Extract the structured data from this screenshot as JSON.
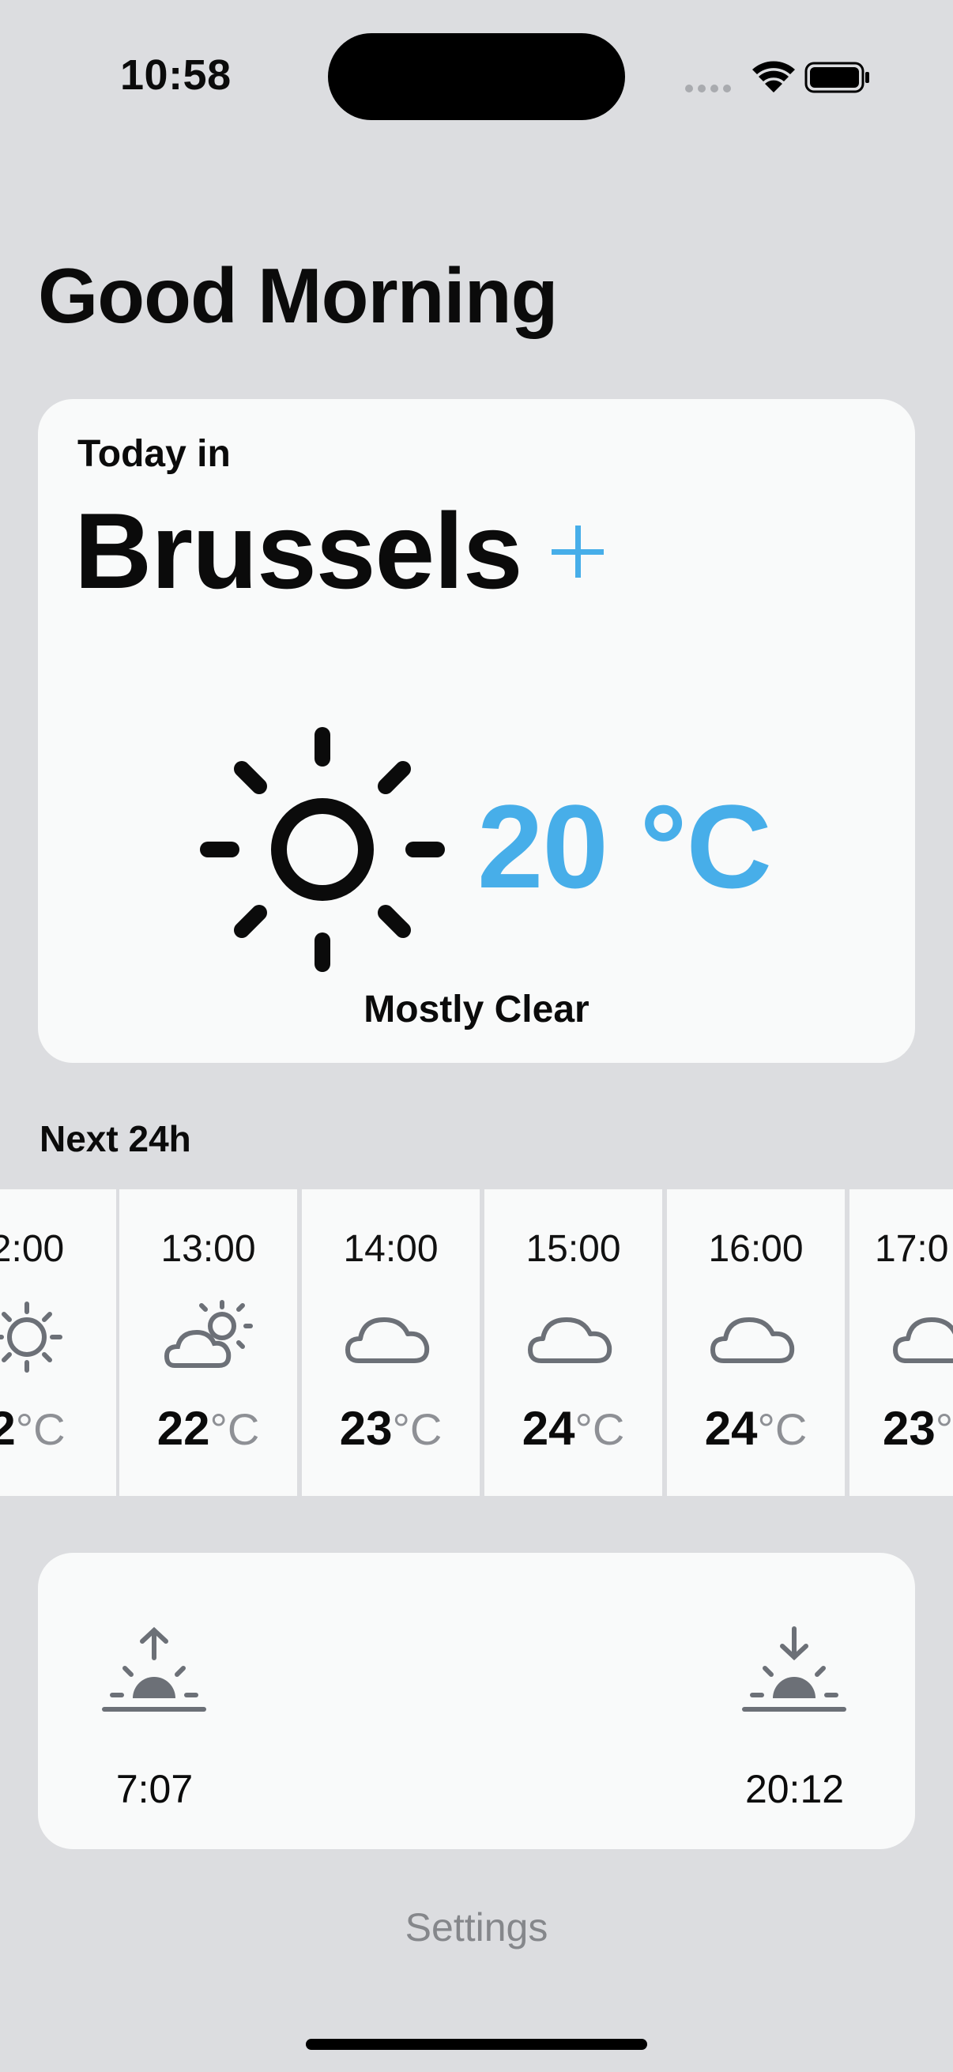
{
  "status_bar": {
    "time": "10:58"
  },
  "greeting": "Good Morning",
  "today": {
    "label": "Today in",
    "city": "Brussels",
    "temperature": "20 °C",
    "condition": "Mostly Clear",
    "icon": "sun-icon"
  },
  "next24": {
    "label": "Next 24h",
    "hours": [
      {
        "time": "2:00",
        "temp": "2",
        "unit": "°C",
        "icon": "sun-icon"
      },
      {
        "time": "13:00",
        "temp": "22",
        "unit": "°C",
        "icon": "partly-cloudy-icon"
      },
      {
        "time": "14:00",
        "temp": "23",
        "unit": "°C",
        "icon": "cloud-icon"
      },
      {
        "time": "15:00",
        "temp": "24",
        "unit": "°C",
        "icon": "cloud-icon"
      },
      {
        "time": "16:00",
        "temp": "24",
        "unit": "°C",
        "icon": "cloud-icon"
      },
      {
        "time": "17:0",
        "temp": "23",
        "unit": "°",
        "icon": "cloud-icon"
      }
    ]
  },
  "sun": {
    "sunrise": "7:07",
    "sunset": "20:12"
  },
  "settings_label": "Settings",
  "colors": {
    "accent": "#47aee9",
    "background": "#dcdde0",
    "card": "#f9fafa",
    "icon_gray": "#6c7077"
  }
}
